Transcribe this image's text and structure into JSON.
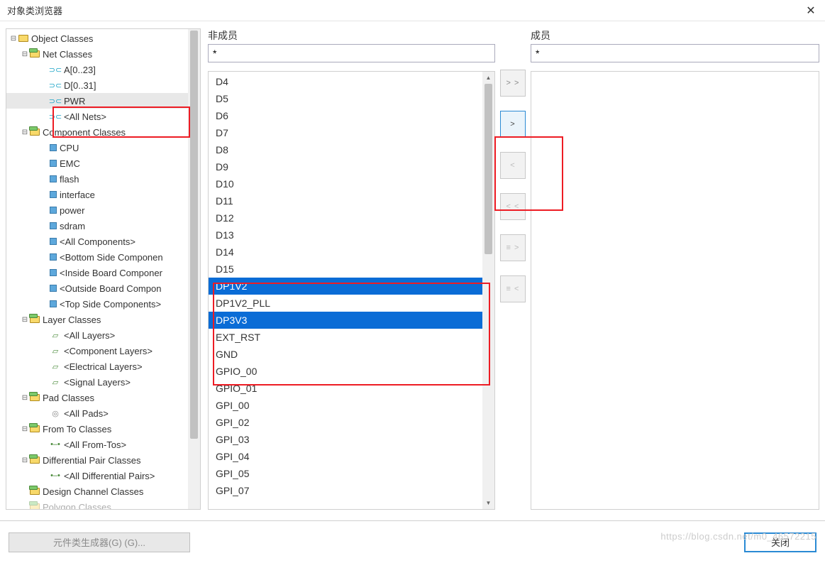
{
  "window": {
    "title": "对象类浏览器"
  },
  "tree": {
    "root": "Object Classes",
    "net_classes": {
      "label": "Net Classes",
      "items": [
        "A[0..23]",
        "D[0..31]",
        "PWR",
        "<All Nets>"
      ],
      "selected": "PWR"
    },
    "component_classes": {
      "label": "Component Classes",
      "items": [
        "CPU",
        "EMC",
        "flash",
        "interface",
        "power",
        "sdram",
        "<All Components>",
        "<Bottom Side Componen",
        "<Inside Board Componer",
        "<Outside Board Compon",
        "<Top Side Components>"
      ]
    },
    "layer_classes": {
      "label": "Layer Classes",
      "items": [
        "<All Layers>",
        "<Component Layers>",
        "<Electrical Layers>",
        "<Signal Layers>"
      ]
    },
    "pad_classes": {
      "label": "Pad Classes",
      "items": [
        "<All Pads>"
      ]
    },
    "from_to_classes": {
      "label": "From To Classes",
      "items": [
        "<All From-Tos>"
      ]
    },
    "diff_pair_classes": {
      "label": "Differential Pair Classes",
      "items": [
        "<All Differential Pairs>"
      ]
    },
    "design_channel_classes": {
      "label": "Design Channel Classes"
    },
    "polygon_classes": {
      "label": "Polygon Classes"
    }
  },
  "nonmember": {
    "title": "非成员",
    "filter": "*",
    "items": [
      "D4",
      "D5",
      "D6",
      "D7",
      "D8",
      "D9",
      "D10",
      "D11",
      "D12",
      "D13",
      "D14",
      "D15",
      "DP1V2",
      "DP1V2_PLL",
      "DP3V3",
      "EXT_RST",
      "GND",
      "GPIO_00",
      "GPIO_01",
      "GPI_00",
      "GPI_02",
      "GPI_03",
      "GPI_04",
      "GPI_05",
      "GPI_07"
    ],
    "selected": [
      "DP1V2",
      "DP3V3"
    ]
  },
  "member": {
    "title": "成员",
    "filter": "*"
  },
  "buttons": {
    "move_all_right": "> >",
    "move_right": ">",
    "move_left": "<",
    "move_all_left": "< <",
    "special1": "≡ >",
    "special2": "≡ <"
  },
  "footer": {
    "generator": "元件类生成器(G) (G)...",
    "close": "关闭"
  },
  "watermark": "https://blog.csdn.net/m0_46572215"
}
